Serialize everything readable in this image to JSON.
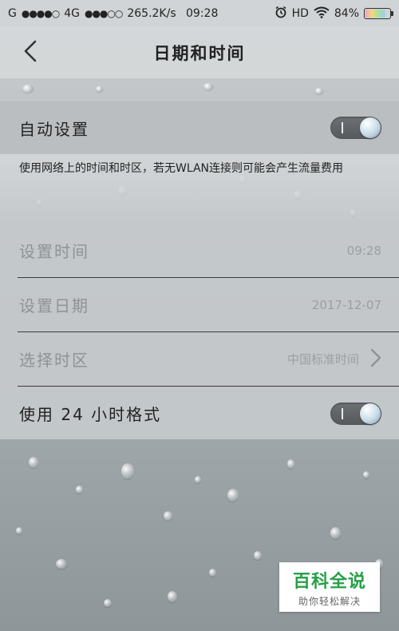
{
  "status_bar": {
    "carrier_1": "G",
    "signal_1": "●●●●○",
    "network": "4G",
    "signal_2": "●●●○○",
    "speed": "265.2K/s",
    "time": "09:28",
    "alarm_icon": "alarm-clock-icon",
    "hd": "HD",
    "wifi_icon": "wifi-icon",
    "battery_text": "84%",
    "battery_level": 0.84
  },
  "header": {
    "back_icon": "chevron-left-icon",
    "title": "日期和时间"
  },
  "auto_setting": {
    "label": "自动设置",
    "toggle_on": true,
    "description": "使用网络上的时间和时区，若无WLAN连接则可能会产生流量费用"
  },
  "rows": {
    "set_time": {
      "label": "设置时间",
      "value": "09:28"
    },
    "set_date": {
      "label": "设置日期",
      "value": "2017-12-07"
    },
    "time_zone": {
      "label": "选择时区",
      "value": "中国标准时间",
      "arrow_icon": "chevron-right-icon"
    },
    "use_24h": {
      "label": "使用 24 小时格式",
      "toggle_on": true
    }
  },
  "watermark": {
    "main": "百科全说",
    "sub": "助你轻松解决"
  }
}
